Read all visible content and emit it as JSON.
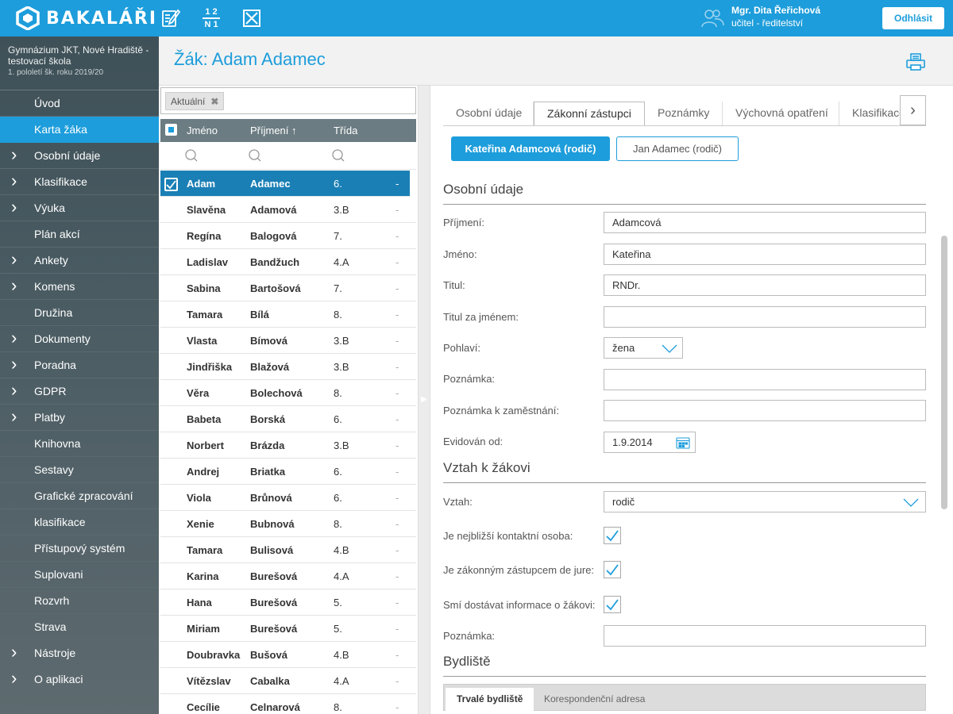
{
  "app": {
    "logo_text": "BAKALÁŘI"
  },
  "topbar": {
    "icons": [
      "pencil-notebook-icon",
      "fraction-icon",
      "crossed-box-icon"
    ],
    "fraction_top": "1 2",
    "fraction_bottom": "N 1",
    "user_name": "Mgr. Dita Řeřichová",
    "user_role": "učitel - ředitelství",
    "logout_label": "Odhlásit",
    "accent": "#1d9ddb"
  },
  "sidebar": {
    "school_name": "Gymnázium JKT, Nové Hradiště - testovací škola",
    "term": "1. pololetí šk. roku 2019/20",
    "items": [
      {
        "label": "Úvod",
        "expandable": false
      },
      {
        "label": "Karta žáka",
        "expandable": false,
        "active": true
      },
      {
        "label": "Osobní údaje",
        "expandable": true
      },
      {
        "label": "Klasifikace",
        "expandable": true
      },
      {
        "label": "Výuka",
        "expandable": true
      },
      {
        "label": "Plán akcí",
        "expandable": false
      },
      {
        "label": "Ankety",
        "expandable": true
      },
      {
        "label": "Komens",
        "expandable": true
      },
      {
        "label": "Družina",
        "expandable": false
      },
      {
        "label": "Dokumenty",
        "expandable": true
      },
      {
        "label": "Poradna",
        "expandable": true
      },
      {
        "label": "GDPR",
        "expandable": true
      },
      {
        "label": "Platby",
        "expandable": true
      },
      {
        "label": "Knihovna",
        "expandable": false
      },
      {
        "label": "Sestavy",
        "expandable": false
      },
      {
        "label": "Grafické zpracování",
        "expandable": false
      },
      {
        "label": "klasifikace",
        "expandable": false
      },
      {
        "label": "Přístupový systém",
        "expandable": false
      },
      {
        "label": "Suplovani",
        "expandable": false
      },
      {
        "label": "Rozvrh",
        "expandable": false
      },
      {
        "label": "Strava",
        "expandable": false
      },
      {
        "label": "Nástroje",
        "expandable": true
      },
      {
        "label": "O aplikaci",
        "expandable": true
      }
    ]
  },
  "header": {
    "title": "Žák: Adam Adamec"
  },
  "student_list": {
    "filter_chip": "Aktuální",
    "columns": {
      "first": "Jméno",
      "last": "Příjmení ↑",
      "class": "Třída"
    },
    "rows": [
      {
        "first": "Adam",
        "last": "Adamec",
        "class": "6.",
        "extra": "-",
        "selected": true
      },
      {
        "first": "Slavěna",
        "last": "Adamová",
        "class": "3.B",
        "extra": "-"
      },
      {
        "first": "Regína",
        "last": "Balogová",
        "class": "7.",
        "extra": "-"
      },
      {
        "first": "Ladislav",
        "last": "Bandžuch",
        "class": "4.A",
        "extra": "-"
      },
      {
        "first": "Sabina",
        "last": "Bartošová",
        "class": "7.",
        "extra": "-"
      },
      {
        "first": "Tamara",
        "last": "Bílá",
        "class": "8.",
        "extra": "-"
      },
      {
        "first": "Vlasta",
        "last": "Bímová",
        "class": "3.B",
        "extra": "-"
      },
      {
        "first": "Jindřiška",
        "last": "Blažová",
        "class": "3.B",
        "extra": "-"
      },
      {
        "first": "Věra",
        "last": "Bolechová",
        "class": "8.",
        "extra": "-"
      },
      {
        "first": "Babeta",
        "last": "Borská",
        "class": "6.",
        "extra": "-"
      },
      {
        "first": "Norbert",
        "last": "Brázda",
        "class": "3.B",
        "extra": "-"
      },
      {
        "first": "Andrej",
        "last": "Briatka",
        "class": "6.",
        "extra": "-"
      },
      {
        "first": "Viola",
        "last": "Brůnová",
        "class": "6.",
        "extra": "-"
      },
      {
        "first": "Xenie",
        "last": "Bubnová",
        "class": "8.",
        "extra": "-"
      },
      {
        "first": "Tamara",
        "last": "Bulisová",
        "class": "4.B",
        "extra": "-"
      },
      {
        "first": "Karina",
        "last": "Burešová",
        "class": "4.A",
        "extra": "-"
      },
      {
        "first": "Hana",
        "last": "Burešová",
        "class": "5.",
        "extra": "-"
      },
      {
        "first": "Miriam",
        "last": "Burešová",
        "class": "5.",
        "extra": "-"
      },
      {
        "first": "Doubravka",
        "last": "Bušová",
        "class": "4.B",
        "extra": "-"
      },
      {
        "first": "Vítězslav",
        "last": "Cabalka",
        "class": "4.A",
        "extra": "-"
      },
      {
        "first": "Cecílie",
        "last": "Celnarová",
        "class": "8.",
        "extra": "-"
      }
    ]
  },
  "detail": {
    "tabs": [
      "Osobní údaje",
      "Zákonní zástupci",
      "Poznámky",
      "Výchovná opatření",
      "Klasifikace"
    ],
    "active_tab": 1,
    "persons": {
      "primary": "Kateřina Adamcová (rodič)",
      "secondary": "Jan Adamec (rodič)"
    },
    "personal": {
      "title": "Osobní údaje",
      "surname_label": "Příjmení:",
      "surname": "Adamcová",
      "name_label": "Jméno:",
      "name": "Kateřina",
      "degree_label": "Titul:",
      "degree": "RNDr.",
      "degree_after_label": "Titul za jménem:",
      "degree_after": "",
      "gender_label": "Pohlaví:",
      "gender": "žena",
      "note_label": "Poznámka:",
      "note": "",
      "job_note_label": "Poznámka k zaměstnání:",
      "job_note": "",
      "registered_label": "Evidován od:",
      "registered": "1.9.2014"
    },
    "relation": {
      "title": "Vztah k žákovi",
      "relation_label": "Vztah:",
      "relation": "rodič",
      "contact_label": "Je nejbližší kontaktní osoba:",
      "contact": true,
      "legal_label": "Je zákonným zástupcem de jure:",
      "legal": true,
      "info_label": "Smí dostávat informace o žákovi:",
      "info": true,
      "note_label": "Poznámka:",
      "note": ""
    },
    "address": {
      "title": "Bydliště",
      "tabs": [
        "Trvalé bydliště",
        "Korespondenční adresa"
      ]
    }
  }
}
